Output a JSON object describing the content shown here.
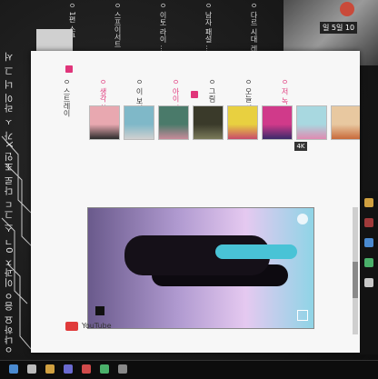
{
  "side_text": "ㅇ냐하요 음ㅇ 이과ㅈ 0ㄱ 스 그ㄷ 다로 조인 X가 ㅅ 라이 너 그 서",
  "top_strip": {
    "items": [
      "ㅇ 1편 스쿠 ...",
      "ㅇ 스프이서트",
      "ㅇ 이토 라이 ...",
      "ㅇ 남자 패설 ...",
      "ㅇ 다르 시대 레어"
    ]
  },
  "photo_thumb": {
    "label": "일 5일 10"
  },
  "menu": {
    "columns": [
      {
        "text": "ㅇ 스트레이",
        "highlight": false
      },
      {
        "text": "ㅇ 생각 합니",
        "highlight": true
      },
      {
        "text": "ㅇ 이 보이 전",
        "highlight": false
      },
      {
        "text": "ㅇ 아이 저 소",
        "highlight": true
      },
      {
        "text": "ㅇ 그림 ㅇ",
        "highlight": false
      },
      {
        "text": "ㅇ 오늘 의 이",
        "highlight": false
      },
      {
        "text": "ㅇ 저 녹 나트",
        "highlight": true
      }
    ]
  },
  "thumbnails": [
    {
      "color_a": "#e8a8b0",
      "color_b": "#2b2b2b"
    },
    {
      "color_a": "#7fb8c8",
      "color_b": "#d0d0d0"
    },
    {
      "color_a": "#4a7a6a",
      "color_b": "#c88a9a"
    },
    {
      "color_a": "#3a3a2a",
      "color_b": "#7a7a5a"
    },
    {
      "color_a": "#e8d040",
      "color_b": "#c84a6a"
    },
    {
      "color_a": "#d03a8a",
      "color_b": "#3a2a6a"
    },
    {
      "color_a": "#a8d8e0",
      "color_b": "#e08ab0"
    },
    {
      "color_a": "#e8c8a0",
      "color_b": "#c86a3a"
    }
  ],
  "player": {
    "badge": "4K"
  },
  "footer": {
    "logo_text": "YouTube"
  },
  "colors": {
    "accent": "#e0357a",
    "taskbar": "#0d0d0d"
  },
  "taskbar_icons": [
    "start-icon",
    "search-icon",
    "browser-icon",
    "folder-icon",
    "media-icon",
    "chat-icon",
    "settings-icon"
  ],
  "tray_icons": [
    "network-icon",
    "volume-icon",
    "battery-icon",
    "notification-icon",
    "clock-icon"
  ]
}
